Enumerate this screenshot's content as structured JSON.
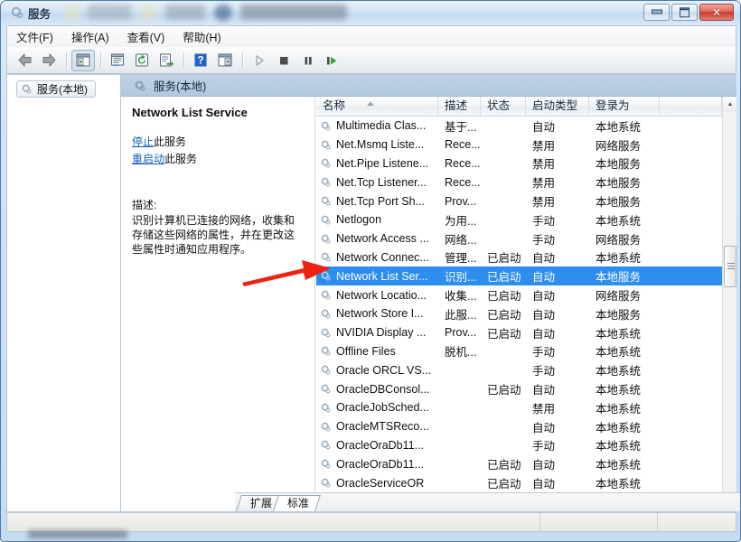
{
  "window": {
    "title": "服务",
    "title_icon": "gear-icon",
    "buttons": {
      "minimize": "—",
      "maximize": "❐",
      "close": "✕"
    }
  },
  "menubar": {
    "items": [
      {
        "label": "文件(F)",
        "name": "menu-file"
      },
      {
        "label": "操作(A)",
        "name": "menu-action"
      },
      {
        "label": "查看(V)",
        "name": "menu-view"
      },
      {
        "label": "帮助(H)",
        "name": "menu-help"
      }
    ]
  },
  "toolbar": {
    "items": [
      {
        "name": "back-icon",
        "glyph": "⬅"
      },
      {
        "name": "forward-icon",
        "glyph": "➡"
      },
      {
        "name": "show-hide-tree-icon",
        "glyph": "▤"
      },
      {
        "name": "properties-icon",
        "glyph": "▣"
      },
      {
        "name": "refresh-icon",
        "glyph": "⟳"
      },
      {
        "name": "export-list-icon",
        "glyph": "⇥"
      },
      {
        "name": "help-icon",
        "glyph": "?"
      },
      {
        "name": "show-action-pane-icon",
        "glyph": "▦"
      },
      {
        "name": "start-service-icon",
        "glyph": "▶"
      },
      {
        "name": "stop-service-icon",
        "glyph": "■"
      },
      {
        "name": "pause-service-icon",
        "glyph": "❙❙"
      },
      {
        "name": "restart-service-icon",
        "glyph": "▶|"
      }
    ]
  },
  "tree": {
    "root": {
      "label": "服务(本地)",
      "icon": "gear-icon"
    }
  },
  "pane_header": {
    "label": "服务(本地)",
    "icon": "gear-icon"
  },
  "details": {
    "service_name": "Network List Service",
    "actions": [
      {
        "link": "停止",
        "suffix": "此服务"
      },
      {
        "link": "重启动",
        "suffix": "此服务"
      }
    ],
    "description_label": "描述:",
    "description_text": "识别计算机已连接的网络，收集和存储这些网络的属性，并在更改这些属性时通知应用程序。"
  },
  "listview": {
    "columns": [
      {
        "label": "名称",
        "name": "column-name",
        "width": 135,
        "sorted": true
      },
      {
        "label": "描述",
        "name": "column-description",
        "width": 47
      },
      {
        "label": "状态",
        "name": "column-status",
        "width": 50
      },
      {
        "label": "启动类型",
        "name": "column-startup-type",
        "width": 70
      },
      {
        "label": "登录为",
        "name": "column-log-on-as",
        "width": 78
      },
      {
        "label": "",
        "name": "column-filler",
        "width": 69
      }
    ],
    "rows": [
      {
        "name": "Multimedia Clas...",
        "description": "基于...",
        "status": "",
        "startup": "自动",
        "logon": "本地系统",
        "selected": false
      },
      {
        "name": "Net.Msmq Liste...",
        "description": "Rece...",
        "status": "",
        "startup": "禁用",
        "logon": "网络服务",
        "selected": false
      },
      {
        "name": "Net.Pipe Listene...",
        "description": "Rece...",
        "status": "",
        "startup": "禁用",
        "logon": "本地服务",
        "selected": false
      },
      {
        "name": "Net.Tcp Listener...",
        "description": "Rece...",
        "status": "",
        "startup": "禁用",
        "logon": "本地服务",
        "selected": false
      },
      {
        "name": "Net.Tcp Port Sh...",
        "description": "Prov...",
        "status": "",
        "startup": "禁用",
        "logon": "本地服务",
        "selected": false
      },
      {
        "name": "Netlogon",
        "description": "为用...",
        "status": "",
        "startup": "手动",
        "logon": "本地系统",
        "selected": false
      },
      {
        "name": "Network Access ...",
        "description": "网络...",
        "status": "",
        "startup": "手动",
        "logon": "网络服务",
        "selected": false
      },
      {
        "name": "Network Connec...",
        "description": "管理...",
        "status": "已启动",
        "startup": "自动",
        "logon": "本地系统",
        "selected": false
      },
      {
        "name": "Network List Ser...",
        "description": "识别...",
        "status": "已启动",
        "startup": "自动",
        "logon": "本地服务",
        "selected": true
      },
      {
        "name": "Network Locatio...",
        "description": "收集...",
        "status": "已启动",
        "startup": "自动",
        "logon": "网络服务",
        "selected": false
      },
      {
        "name": "Network Store I...",
        "description": "此服...",
        "status": "已启动",
        "startup": "自动",
        "logon": "本地服务",
        "selected": false
      },
      {
        "name": "NVIDIA Display ...",
        "description": "Prov...",
        "status": "已启动",
        "startup": "自动",
        "logon": "本地系统",
        "selected": false
      },
      {
        "name": "Offline Files",
        "description": "脱机...",
        "status": "",
        "startup": "手动",
        "logon": "本地系统",
        "selected": false
      },
      {
        "name": "Oracle ORCL VS...",
        "description": "",
        "status": "",
        "startup": "手动",
        "logon": "本地系统",
        "selected": false
      },
      {
        "name": "OracleDBConsol...",
        "description": "",
        "status": "已启动",
        "startup": "自动",
        "logon": "本地系统",
        "selected": false
      },
      {
        "name": "OracleJobSched...",
        "description": "",
        "status": "",
        "startup": "禁用",
        "logon": "本地系统",
        "selected": false
      },
      {
        "name": "OracleMTSReco...",
        "description": "",
        "status": "",
        "startup": "自动",
        "logon": "本地系统",
        "selected": false
      },
      {
        "name": "OracleOraDb11...",
        "description": "",
        "status": "",
        "startup": "手动",
        "logon": "本地系统",
        "selected": false
      },
      {
        "name": "OracleOraDb11...",
        "description": "",
        "status": "已启动",
        "startup": "自动",
        "logon": "本地系统",
        "selected": false
      },
      {
        "name": "OracleServiceOR",
        "description": "",
        "status": "已启动",
        "startup": "自动",
        "logon": "本地系统",
        "selected": false
      }
    ],
    "scrollbar": {
      "up": "▲",
      "down": "▼"
    }
  },
  "tabs": [
    {
      "label": "扩展",
      "name": "tab-extended",
      "active": false
    },
    {
      "label": "标准",
      "name": "tab-standard",
      "active": true
    }
  ],
  "annotation": {
    "type": "red-arrow",
    "color": "#ee2211",
    "points_to": "Network List Ser..."
  },
  "colors": {
    "selection": "#2e8ef0",
    "link": "#1560bd",
    "annotation": "#ee2211",
    "header_band": "#b2c9dd"
  }
}
